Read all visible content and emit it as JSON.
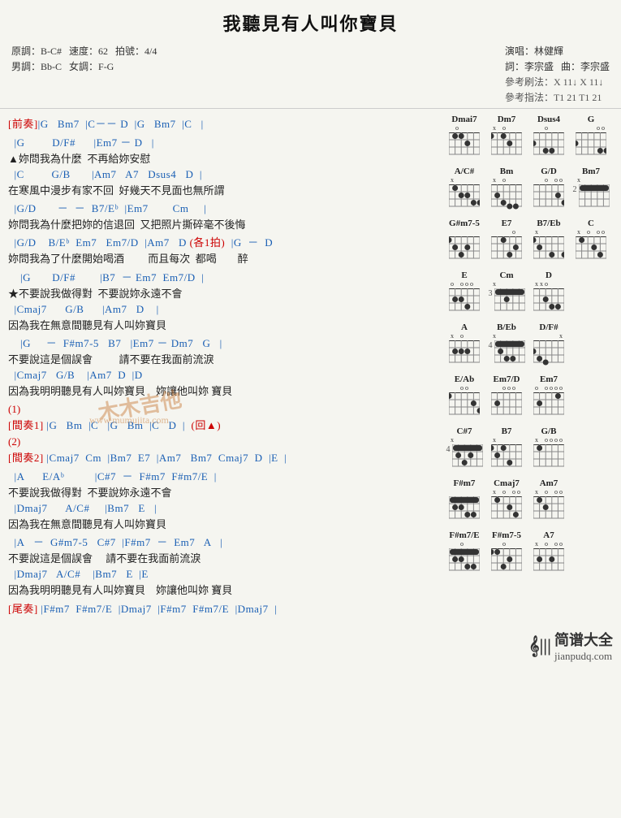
{
  "title": "我聽見有人叫你寶貝",
  "meta": {
    "original_key": "原調：B-C#",
    "tempo": "速度：62",
    "time_sig": "拍號：4/4",
    "male_key": "男調：Bb-C",
    "female_key": "女調：F-G",
    "performer": "演唱：林健輝",
    "lyricist": "詞：李宗盛",
    "composer": "曲：李宗盛",
    "ref_strum1": "參考刷法：X 11↓ X 11↓",
    "ref_finger1": "參考指法：T1 21 T1 21"
  },
  "sections": [
    {
      "id": "prelude",
      "label": "[前奏]",
      "lines": [
        "|G   Bm7  |C－－ D  |G   Bm7  |C   |"
      ]
    },
    {
      "id": "verse1a",
      "label": "",
      "lines": [
        "  |G         D/F#      |Em7 － D   |",
        "▲妳問我為什麼  不再給妳安慰",
        "  |C         G/B       |Am7   A7   Dsus4   D  |",
        "在寒風中漫步有家不回  好幾天不見面也無所謂",
        "  |G/D       －  －  B7/Eb  |Em7        Cm     |",
        "妳問我為什麼把妳的信退回  又把照片撕碎毫不後悔",
        "  |G/D    B/Eb  Em7   Em7/D  |Am7   D  (各1拍)  |G  －  D",
        "妳問我為了什麼開始喝酒         而且每次  都喝        醉"
      ]
    },
    {
      "id": "chorus1",
      "label": "",
      "lines": [
        "    |G       D/F#        |B7  － Em7  Em7/D  |",
        "★不要說我做得對  不要說妳永遠不會",
        "  |Cmaj7      G/B      |Am7   D    |",
        "因為我在無意間聽見有人叫妳寶貝",
        "    |G     －  F#m7-5   B7   |Em7 － Dm7   G   |",
        "不要說這是個誤會          請不要在我面前流淚",
        "  |Cmaj7   G/B    |Am7  D  |D",
        "因為我明明聽見有人叫妳寶貝    妳讓他叫妳 寶貝"
      ]
    },
    {
      "id": "interlude1",
      "label": "(1)",
      "lines": [
        "[間奏1] |G   Bm  |C   |G   Bm  |C   D  |  (回▲)"
      ]
    },
    {
      "id": "interlude2",
      "label": "(2)",
      "lines": [
        "[間奏2] |Cmaj7  Cm  |Bm7  E7  |Am7   Bm7  Cmaj7  D  |E  |",
        "",
        "  |A      E/Ab          |C#7  －  F#m7  F#m7/E  |",
        "不要說我做得對  不要說妳永遠不會",
        "  |Dmaj7      A/C#     |Bm7   E   |",
        "因為我在無意間聽見有人叫妳寶貝",
        "  |A   －  G#m7-5   C#7  |F#m7  －  Em7   A   |",
        "不要說這是個誤會     請不要在我面前流淚",
        "  |Dmaj7   A/C#    |Bm7   E  |E",
        "因為我明明聽見有人叫妳寶貝    妳讓他叫妳 寶貝"
      ]
    },
    {
      "id": "outro",
      "label": "",
      "lines": [
        "[尾奏] |F#m7  F#m7/E  |Dmaj7  |F#m7  F#m7/E  |Dmaj7  |"
      ]
    }
  ],
  "chord_diagrams": [
    {
      "row": [
        {
          "name": "Dmai7",
          "open": [
            "",
            "o",
            "",
            "",
            "",
            ""
          ],
          "fret": "",
          "dots": [
            [
              1,
              2
            ],
            [
              1,
              3
            ],
            [
              2,
              4
            ]
          ],
          "barre": null
        },
        {
          "name": "Dm7",
          "open": [
            "x",
            "",
            "o",
            "",
            "",
            ""
          ],
          "fret": "",
          "dots": [
            [
              1,
              1
            ],
            [
              1,
              3
            ],
            [
              2,
              2
            ]
          ],
          "barre": null
        },
        {
          "name": "Dsus4",
          "open": [
            "",
            "",
            "o",
            "",
            "",
            ""
          ],
          "fret": "",
          "dots": [
            [
              2,
              1
            ],
            [
              3,
              2
            ],
            [
              3,
              3
            ]
          ],
          "barre": null
        },
        {
          "name": "G",
          "open": [
            "",
            "",
            "",
            "",
            "o",
            "o"
          ],
          "fret": "",
          "dots": [
            [
              2,
              1
            ],
            [
              3,
              5
            ],
            [
              3,
              6
            ]
          ],
          "barre": null
        }
      ]
    },
    {
      "row": [
        {
          "name": "A/C#",
          "open": [
            "x",
            "",
            "",
            "",
            "",
            ""
          ],
          "fret": "",
          "dots": [
            [
              1,
              2
            ],
            [
              2,
              3
            ],
            [
              2,
              4
            ],
            [
              3,
              5
            ],
            [
              3,
              6
            ]
          ],
          "barre": null
        },
        {
          "name": "Bm",
          "open": [
            "x",
            "",
            "o",
            "",
            "",
            ""
          ],
          "fret": "",
          "dots": [
            [
              2,
              2
            ],
            [
              3,
              3
            ],
            [
              4,
              4
            ],
            [
              4,
              5
            ]
          ],
          "barre": null
        },
        {
          "name": "G/D",
          "open": [
            "",
            "",
            "o",
            "",
            "o",
            "o"
          ],
          "fret": "",
          "dots": [
            [
              2,
              5
            ],
            [
              3,
              6
            ]
          ],
          "barre": null
        },
        {
          "name": "Bm7",
          "open": [
            "x",
            "",
            "",
            "",
            "",
            ""
          ],
          "fret": "2",
          "dots": [
            [
              1,
              2
            ],
            [
              1,
              3
            ],
            [
              1,
              4
            ],
            [
              1,
              5
            ]
          ],
          "barre": {
            "fret": 1,
            "from": 2,
            "to": 5
          }
        }
      ]
    },
    {
      "row": [
        {
          "name": "G#m7-5",
          "open": [
            "",
            "",
            "",
            "",
            "",
            ""
          ],
          "fret": "",
          "dots": [
            [
              1,
              1
            ],
            [
              2,
              2
            ],
            [
              2,
              4
            ],
            [
              3,
              3
            ]
          ],
          "barre": null
        },
        {
          "name": "E7",
          "open": [
            "",
            "",
            "",
            "",
            "o",
            ""
          ],
          "fret": "",
          "dots": [
            [
              1,
              3
            ],
            [
              2,
              5
            ],
            [
              3,
              4
            ]
          ],
          "barre": null
        },
        {
          "name": "B7/Eb",
          "open": [
            "x",
            "",
            "",
            "",
            "",
            ""
          ],
          "fret": "",
          "dots": [
            [
              1,
              1
            ],
            [
              2,
              2
            ],
            [
              3,
              3
            ],
            [
              3,
              5
            ]
          ],
          "barre": null
        },
        {
          "name": "C",
          "open": [
            "x",
            "",
            "o",
            "",
            "o",
            "o"
          ],
          "fret": "",
          "dots": [
            [
              1,
              2
            ],
            [
              2,
              4
            ],
            [
              3,
              5
            ]
          ],
          "barre": null
        }
      ]
    },
    {
      "row": [
        {
          "name": "E",
          "open": [
            "",
            "",
            "o",
            "o",
            "o",
            ""
          ],
          "fret": "",
          "dots": [
            [
              2,
              4
            ],
            [
              2,
              5
            ],
            [
              3,
              6
            ]
          ],
          "barre": null
        },
        {
          "name": "Cm",
          "open": [
            "x",
            "",
            "",
            "",
            "",
            ""
          ],
          "fret": "3",
          "dots": [
            [
              1,
              1
            ],
            [
              1,
              2
            ],
            [
              2,
              3
            ]
          ],
          "barre": {
            "fret": 1,
            "from": 1,
            "to": 5
          }
        },
        {
          "name": "D",
          "open": [
            "x",
            "x",
            "o",
            "",
            "",
            ""
          ],
          "fret": "",
          "dots": [
            [
              2,
              3
            ],
            [
              3,
              4
            ],
            [
              3,
              5
            ]
          ],
          "barre": null
        }
      ]
    },
    {
      "row": [
        {
          "name": "A",
          "open": [
            "x",
            "",
            "o",
            "",
            "",
            ""
          ],
          "fret": "",
          "dots": [
            [
              2,
              2
            ],
            [
              2,
              3
            ],
            [
              2,
              4
            ]
          ],
          "barre": null
        },
        {
          "name": "B/Eb",
          "open": [
            "x",
            "",
            "",
            "",
            "",
            ""
          ],
          "fret": "4",
          "dots": [
            [
              1,
              1
            ],
            [
              2,
              2
            ],
            [
              3,
              3
            ],
            [
              3,
              4
            ]
          ],
          "barre": {
            "fret": 1,
            "from": 1,
            "to": 5
          }
        },
        {
          "name": "D/F#",
          "open": [
            "",
            "",
            "",
            "",
            "",
            "x"
          ],
          "fret": "",
          "dots": [
            [
              2,
              1
            ],
            [
              3,
              2
            ],
            [
              4,
              3
            ]
          ],
          "barre": null
        }
      ]
    },
    {
      "row": [
        {
          "name": "E/Ab",
          "open": [
            "",
            "",
            "o",
            "o",
            "",
            ""
          ],
          "fret": "",
          "dots": [
            [
              1,
              1
            ],
            [
              2,
              5
            ],
            [
              3,
              6
            ]
          ],
          "barre": null
        },
        {
          "name": "Em7/D",
          "open": [
            "",
            "",
            "o",
            "o",
            "o",
            ""
          ],
          "fret": "",
          "dots": [
            [
              2,
              2
            ]
          ],
          "barre": null
        },
        {
          "name": "Em7",
          "open": [
            "",
            "",
            "o",
            "o",
            "o",
            "o"
          ],
          "fret": "",
          "dots": [
            [
              2,
              5
            ]
          ],
          "barre": null
        }
      ]
    },
    {
      "row": [
        {
          "name": "C#7",
          "open": [
            "x",
            "",
            "",
            "",
            "",
            ""
          ],
          "fret": "4",
          "dots": [
            [
              1,
              1
            ],
            [
              2,
              2
            ],
            [
              2,
              4
            ],
            [
              3,
              3
            ]
          ],
          "barre": {
            "fret": 1,
            "from": 1,
            "to": 5
          }
        },
        {
          "name": "B7",
          "open": [
            "x",
            "",
            "",
            "",
            "",
            ""
          ],
          "fret": "",
          "dots": [
            [
              1,
              1
            ],
            [
              1,
              3
            ],
            [
              2,
              2
            ],
            [
              3,
              4
            ]
          ],
          "barre": null
        },
        {
          "name": "G/B",
          "open": [
            "x",
            "",
            "o",
            "o",
            "o",
            "o"
          ],
          "fret": "",
          "dots": [
            [
              1,
              2
            ]
          ],
          "barre": null
        }
      ]
    },
    {
      "row": [
        {
          "name": "F#m7",
          "open": [
            "",
            "",
            "",
            "",
            "",
            ""
          ],
          "fret": "",
          "dots": [
            [
              1,
              1
            ],
            [
              1,
              2
            ],
            [
              2,
              3
            ],
            [
              2,
              4
            ],
            [
              3,
              5
            ],
            [
              3,
              6
            ]
          ],
          "barre": {
            "fret": 1,
            "from": 1,
            "to": 6
          }
        },
        {
          "name": "Cmaj7",
          "open": [
            "x",
            "",
            "o",
            "",
            "o",
            "o"
          ],
          "fret": "",
          "dots": [
            [
              1,
              2
            ],
            [
              2,
              4
            ],
            [
              3,
              5
            ]
          ],
          "barre": null
        },
        {
          "name": "Am7",
          "open": [
            "x",
            "",
            "o",
            "",
            "o",
            "o"
          ],
          "fret": "",
          "dots": [
            [
              1,
              2
            ],
            [
              2,
              3
            ]
          ],
          "barre": null
        }
      ]
    },
    {
      "row": [
        {
          "name": "F#m7/E",
          "open": [
            "",
            "",
            "o",
            "",
            "",
            ""
          ],
          "fret": "",
          "dots": [
            [
              1,
              1
            ],
            [
              1,
              2
            ],
            [
              2,
              3
            ],
            [
              2,
              4
            ],
            [
              3,
              5
            ],
            [
              3,
              6
            ]
          ],
          "barre": {
            "fret": 1,
            "from": 1,
            "to": 6
          }
        },
        {
          "name": "F#m7-5",
          "open": [
            "",
            "",
            "o",
            "",
            "",
            ""
          ],
          "fret": "",
          "dots": [
            [
              1,
              1
            ],
            [
              1,
              2
            ],
            [
              2,
              4
            ],
            [
              3,
              3
            ]
          ],
          "barre": null
        },
        {
          "name": "A7",
          "open": [
            "x",
            "",
            "o",
            "",
            "o",
            "o"
          ],
          "fret": "",
          "dots": [
            [
              2,
              2
            ],
            [
              2,
              4
            ]
          ],
          "barre": null
        }
      ]
    }
  ],
  "watermark": "木木吉他",
  "watermark_url": "www.mumujita.com",
  "footer": {
    "piano_icon": "|||",
    "site_name": "简谱大全",
    "site_url": "jianpudq.com"
  }
}
